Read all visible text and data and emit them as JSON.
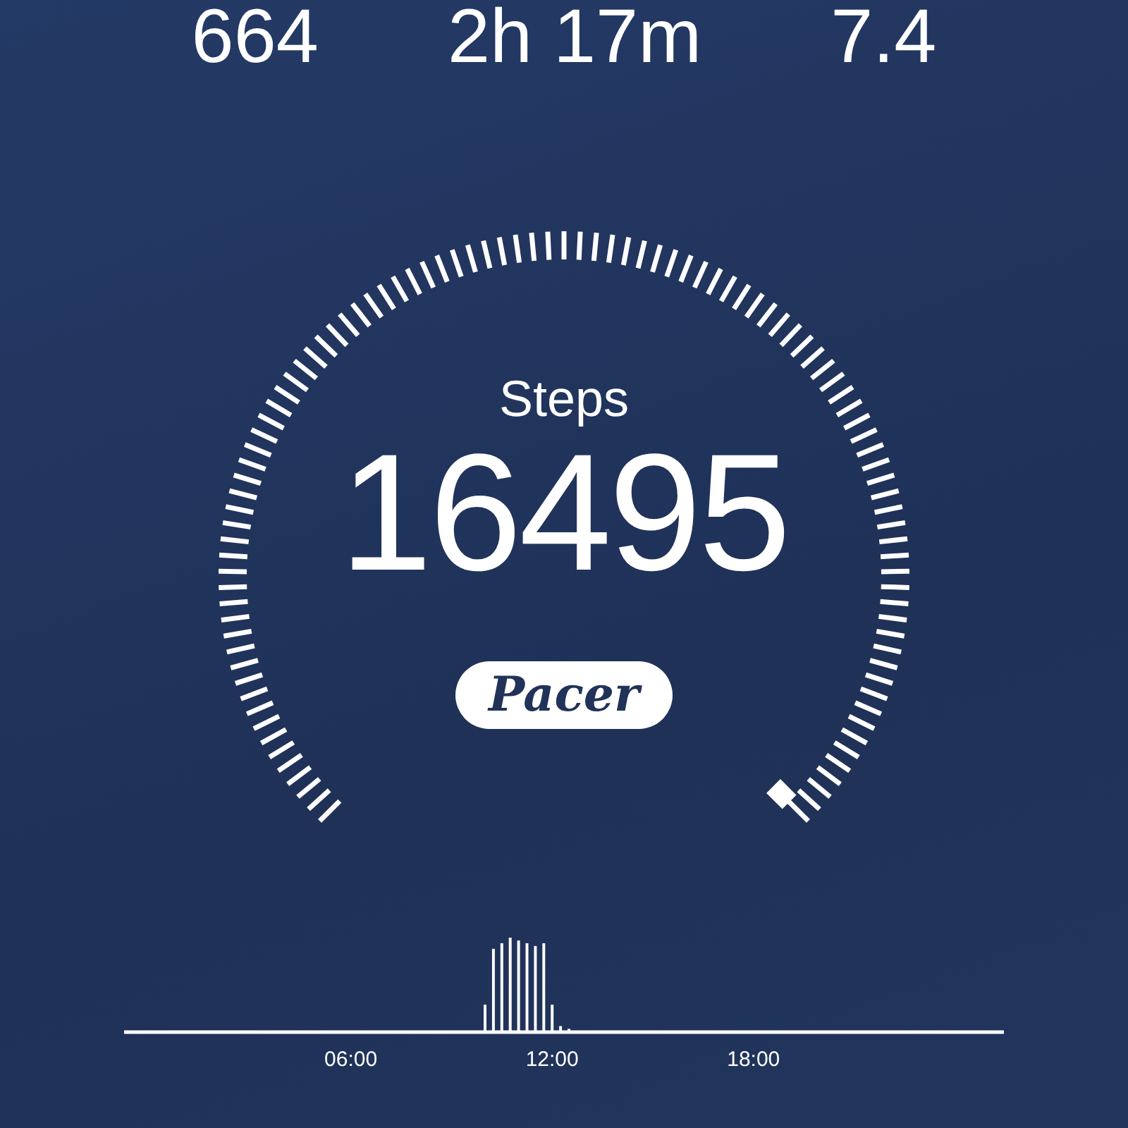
{
  "stats": [
    {
      "value": "664"
    },
    {
      "value": "2h 17m"
    },
    {
      "value": "7.4"
    }
  ],
  "gauge": {
    "label": "Steps",
    "value": "16495"
  },
  "brand": {
    "label": "Pacer"
  },
  "timeline": {
    "ticks": [
      "06:00",
      "12:00",
      "18:00"
    ]
  }
}
